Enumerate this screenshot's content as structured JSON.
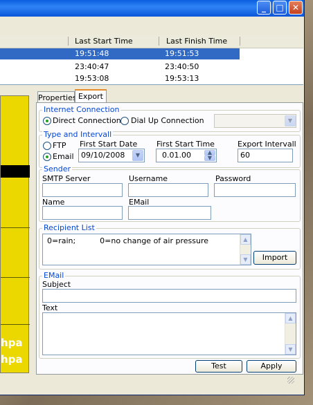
{
  "window": {
    "title_buttons": {
      "minimize": "_",
      "maximize": "□",
      "close": "✕"
    }
  },
  "table": {
    "columns": [
      "Last Start Time",
      "Last Finish Time"
    ],
    "rows": [
      {
        "start": "19:51:48",
        "finish": "19:51:53",
        "selected": true
      },
      {
        "start": "23:40:47",
        "finish": "23:40:50",
        "selected": false
      },
      {
        "start": "19:53:08",
        "finish": "19:53:13",
        "selected": false
      }
    ]
  },
  "side_panel": {
    "lines": [
      "hpa",
      "hpa"
    ]
  },
  "tabs": [
    {
      "label": "Properties",
      "active": false
    },
    {
      "label": "Export",
      "active": true
    }
  ],
  "internet_connection": {
    "title": "Internet Connection",
    "direct": "Direct Connection",
    "dialup": "Dial Up Connection",
    "dialup_value": ""
  },
  "type_interval": {
    "title": "Type and Intervall",
    "ftp": "FTP",
    "email": "Email",
    "first_start_date_label": "First Start Date",
    "first_start_date": "09/10/2008",
    "first_start_time_label": "First Start Time",
    "first_start_time": "0.01.00",
    "export_interval_label": "Export Intervall",
    "export_interval": "60"
  },
  "sender": {
    "title": "Sender",
    "smtp_label": "SMTP Server",
    "smtp_value": "",
    "username_label": "Username",
    "username_value": "",
    "password_label": "Password",
    "password_value": "",
    "name_label": "Name",
    "name_value": "",
    "email_label": "EMail",
    "email_value": ""
  },
  "recipients": {
    "title": "Recipient List",
    "text": "0=rain;          0=no change of air pressure",
    "import_label": "Import"
  },
  "email": {
    "title": "EMail",
    "subject_label": "Subject",
    "subject_value": "",
    "text_label": "Text",
    "text_value": ""
  },
  "actions": {
    "test_label": "Test",
    "apply_label": "Apply"
  }
}
